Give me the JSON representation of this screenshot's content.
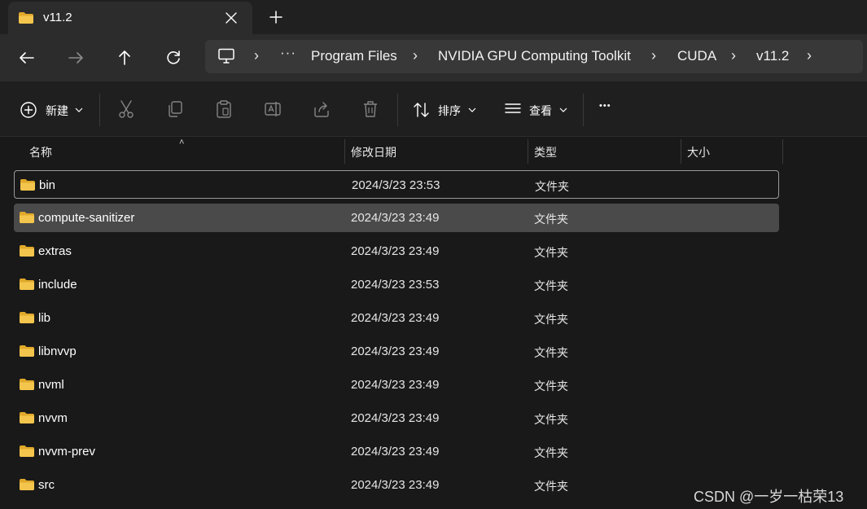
{
  "tab": {
    "title": "v11.2"
  },
  "breadcrumb": {
    "overflow": "···",
    "items": [
      "Program Files",
      "NVIDIA GPU Computing Toolkit",
      "CUDA",
      "v11.2"
    ]
  },
  "toolbar": {
    "new_label": "新建",
    "sort_label": "排序",
    "view_label": "查看",
    "more_label": "•••"
  },
  "columns": [
    "名称",
    "修改日期",
    "类型",
    "大小"
  ],
  "files": [
    {
      "name": "bin",
      "date": "2024/3/23 23:53",
      "type": "文件夹"
    },
    {
      "name": "compute-sanitizer",
      "date": "2024/3/23 23:49",
      "type": "文件夹"
    },
    {
      "name": "extras",
      "date": "2024/3/23 23:49",
      "type": "文件夹"
    },
    {
      "name": "include",
      "date": "2024/3/23 23:53",
      "type": "文件夹"
    },
    {
      "name": "lib",
      "date": "2024/3/23 23:49",
      "type": "文件夹"
    },
    {
      "name": "libnvvp",
      "date": "2024/3/23 23:49",
      "type": "文件夹"
    },
    {
      "name": "nvml",
      "date": "2024/3/23 23:49",
      "type": "文件夹"
    },
    {
      "name": "nvvm",
      "date": "2024/3/23 23:49",
      "type": "文件夹"
    },
    {
      "name": "nvvm-prev",
      "date": "2024/3/23 23:49",
      "type": "文件夹"
    },
    {
      "name": "src",
      "date": "2024/3/23 23:49",
      "type": "文件夹"
    }
  ],
  "watermark": "CSDN @一岁一枯荣13",
  "colors": {
    "folder": "#f4c54d",
    "folder_dark": "#e0a92a",
    "selected_row": "#4a4a4a",
    "background": "#191919"
  }
}
